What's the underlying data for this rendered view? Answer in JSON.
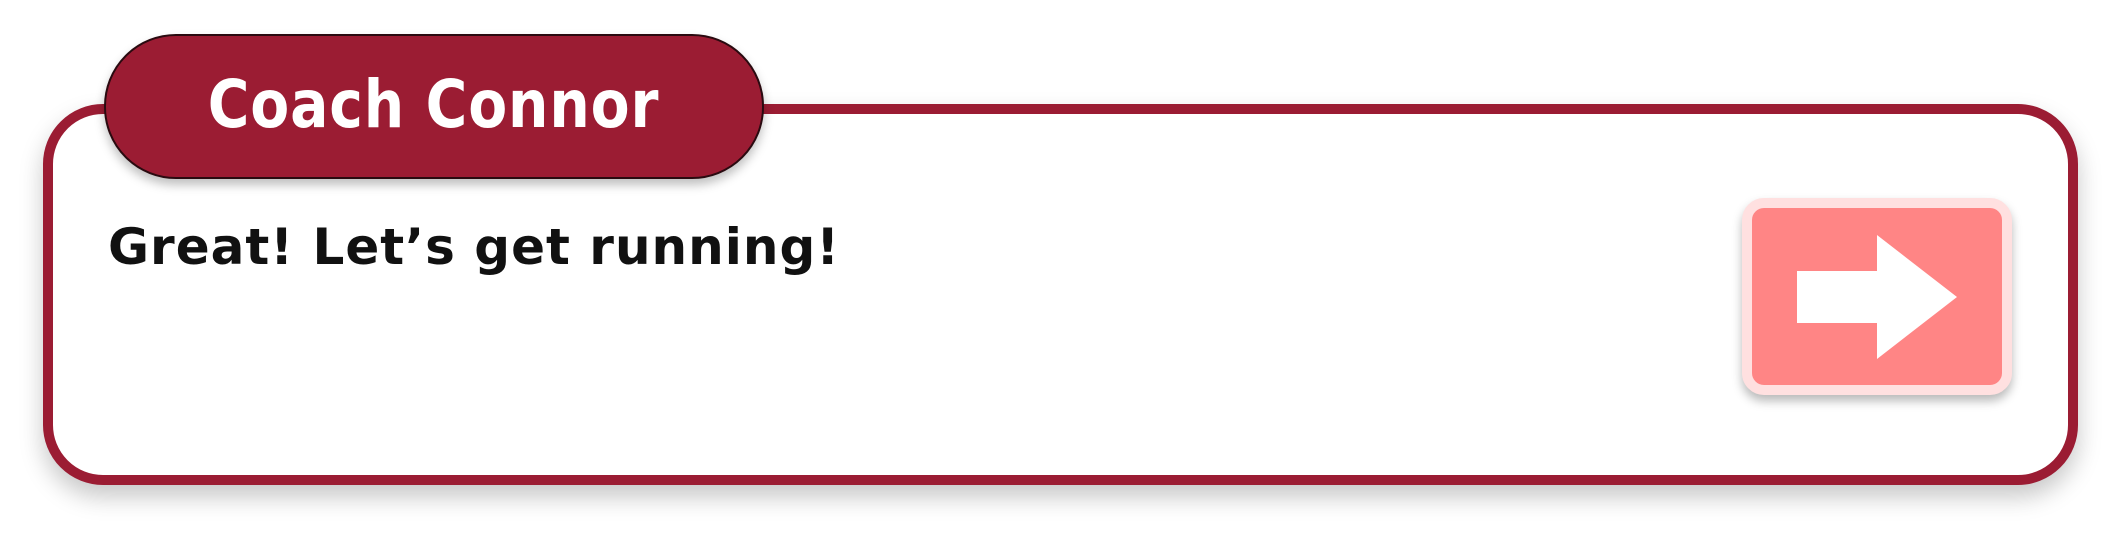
{
  "dialog": {
    "speaker_name": "Coach Connor",
    "message": "Great! Let’s get running!"
  },
  "next_button": {
    "icon": "arrow-right-icon"
  },
  "colors": {
    "frame": "#9b1c33",
    "name_tab": "#9b1c33",
    "button_fill": "#ff8585",
    "button_border": "#ffe0e0",
    "text": "#111111",
    "background": "#ffffff"
  }
}
